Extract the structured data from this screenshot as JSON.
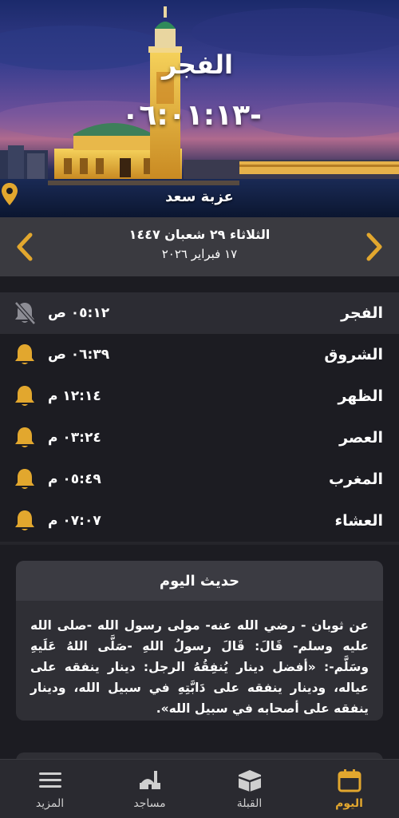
{
  "hero": {
    "prayer_name": "الفجر",
    "countdown": "-٠٦:٠١:١٣",
    "location": "عزبة سعد"
  },
  "date": {
    "hijri": "الثلاثاء ٢٩ شعبان ١٤٤٧",
    "gregorian": "١٧ فبراير ٢٠٢٦"
  },
  "prayers": [
    {
      "name": "الفجر",
      "time": "٠٥:١٢ ص",
      "alarm": "muted"
    },
    {
      "name": "الشروق",
      "time": "٠٦:٣٩ ص",
      "alarm": "on"
    },
    {
      "name": "الظهر",
      "time": "١٢:١٤ م",
      "alarm": "on"
    },
    {
      "name": "العصر",
      "time": "٠٣:٢٤ م",
      "alarm": "on"
    },
    {
      "name": "المغرب",
      "time": "٠٥:٤٩ م",
      "alarm": "on"
    },
    {
      "name": "العشاء",
      "time": "٠٧:٠٧ م",
      "alarm": "on"
    }
  ],
  "hadith": {
    "title": "حديث اليوم",
    "text": "عن ثوبان - رضي الله عنه- مولى رسول الله -صلى الله عليه وسلم- قَالَ: قَالَ رسولُ اللهِ -صَلَّى اللهُ عَلَيهِ وسَلَّم-: «أفضل دينار يُنفِقُهُ الرجل: دينار ينفقه على عياله، ودينار ينفقه على دَابَّتِهِ في سبيل الله، ودينار ينفقه على أصحابه في سبيل الله»."
  },
  "bottom_nav": [
    {
      "label": "المزيد",
      "icon": "menu-icon",
      "active": false
    },
    {
      "label": "مساجد",
      "icon": "mosque-icon",
      "active": false
    },
    {
      "label": "القبلة",
      "icon": "kaaba-icon",
      "active": false
    },
    {
      "label": "اليوم",
      "icon": "calendar-icon",
      "active": true
    }
  ],
  "colors": {
    "accent": "#e2a72e",
    "background": "#1c1c22",
    "row_highlight": "#2c2c33",
    "date_bar": "#3a3a40"
  }
}
